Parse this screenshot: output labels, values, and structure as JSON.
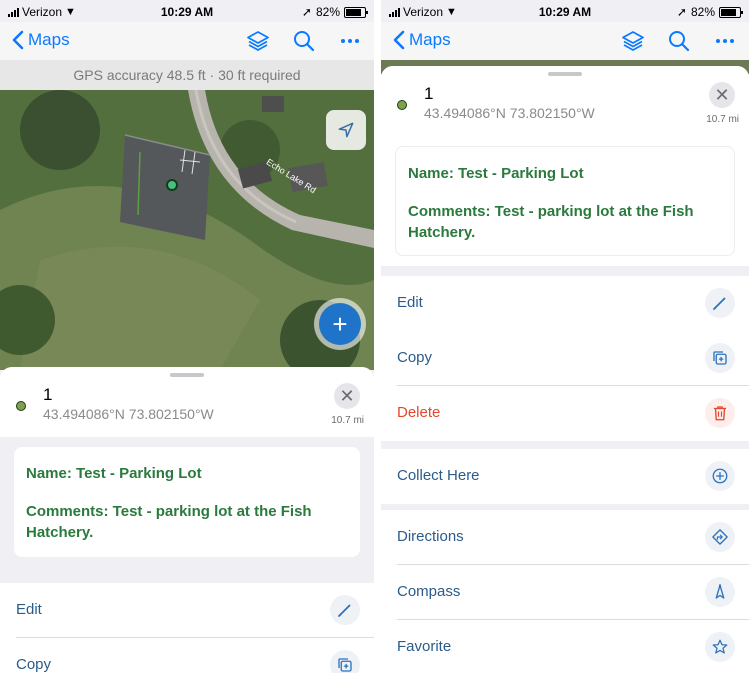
{
  "status": {
    "carrier": "Verizon",
    "time": "10:29 AM",
    "battery": "82%"
  },
  "nav": {
    "back_label": "Maps"
  },
  "gps": {
    "accuracy_text": "GPS accuracy 48.5 ft  ·  30 ft required"
  },
  "map": {
    "road_label": "Echo Lake Rd"
  },
  "feature": {
    "title": "1",
    "coordinates": "43.494086°N 73.802150°W",
    "distance": "10.7 mi",
    "name_line": "Name: Test - Parking Lot",
    "comments_line": "Comments: Test - parking lot at the Fish Hatchery."
  },
  "actions": {
    "edit": "Edit",
    "copy": "Copy",
    "delete": "Delete",
    "collect_here": "Collect Here",
    "directions": "Directions",
    "compass": "Compass",
    "favorite": "Favorite"
  },
  "colors": {
    "accent": "#0a7aff",
    "green_text": "#2b7a3d",
    "delete_red": "#e8442e",
    "action_blue": "#2a5b8a"
  }
}
